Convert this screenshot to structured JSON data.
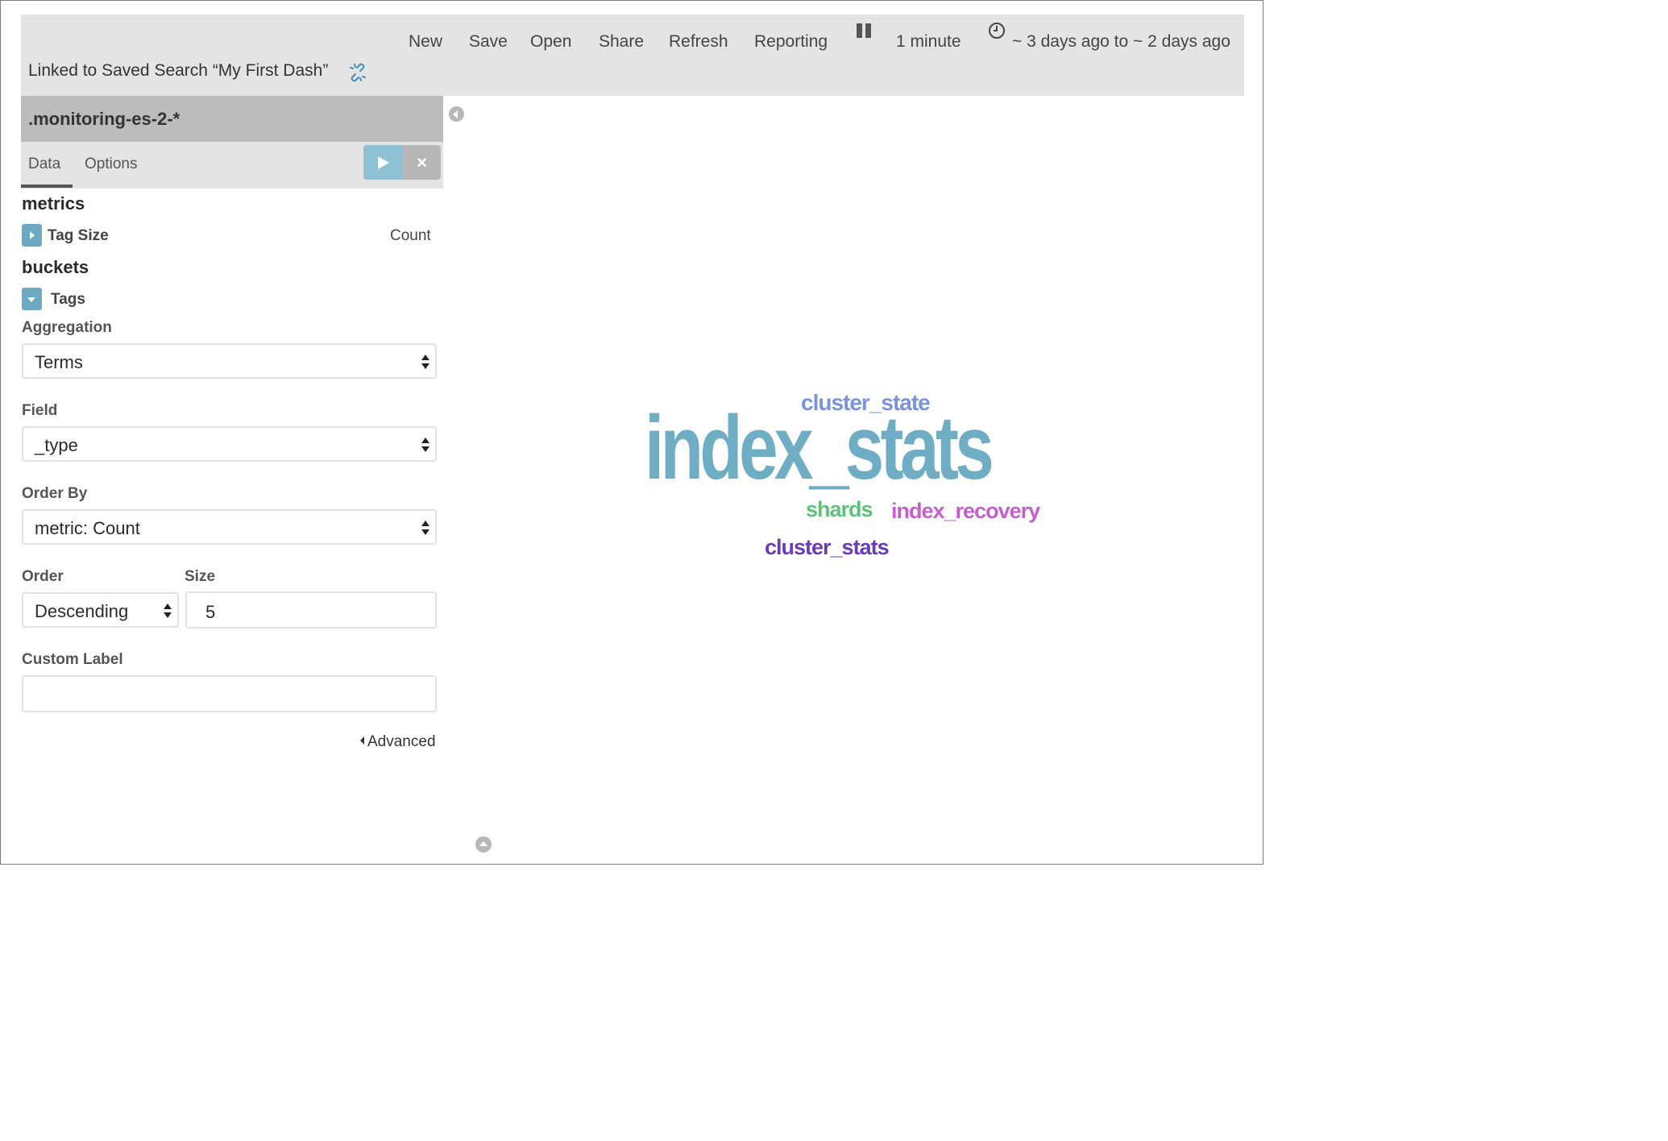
{
  "toolbar": {
    "menu": [
      "New",
      "Save",
      "Open",
      "Share",
      "Refresh",
      "Reporting"
    ],
    "refresh_interval": "1 minute",
    "time_range": "~ 3 days ago to ~ 2 days ago",
    "pause_icon": "pause-icon",
    "clock_icon": "clock-icon"
  },
  "saved_search": {
    "label": "Linked to Saved Search “My First Dash”",
    "unlink_icon": "unlink-icon"
  },
  "sidebar": {
    "index_pattern": ".monitoring-es-2-*",
    "tabs": [
      "Data",
      "Options"
    ],
    "active_tab": "Data",
    "apply_icon": "play-icon",
    "discard_label": "×",
    "metrics": {
      "title": "metrics",
      "item_label": "Tag Size",
      "item_value": "Count"
    },
    "buckets": {
      "title": "buckets",
      "item_label": "Tags",
      "aggregation": {
        "label": "Aggregation",
        "value": "Terms"
      },
      "field": {
        "label": "Field",
        "value": "_type"
      },
      "order_by": {
        "label": "Order By",
        "value": "metric: Count"
      },
      "order": {
        "label": "Order",
        "value": "Descending"
      },
      "size": {
        "label": "Size",
        "value": "5"
      },
      "custom_label": {
        "label": "Custom Label",
        "value": ""
      },
      "advanced_link": "Advanced"
    }
  },
  "colors": {
    "accent": "#6ea9c2",
    "toolbar_bg": "#e4e4e4",
    "header_bg": "#bcbcbc"
  },
  "tag_cloud": {
    "words": [
      {
        "text": "index_stats",
        "color": "#6fadc5"
      },
      {
        "text": "cluster_state",
        "color": "#7a93db"
      },
      {
        "text": "shards",
        "color": "#5ec27a"
      },
      {
        "text": "index_recovery",
        "color": "#c45fcb"
      },
      {
        "text": "cluster_stats",
        "color": "#6a3cb8"
      }
    ]
  }
}
